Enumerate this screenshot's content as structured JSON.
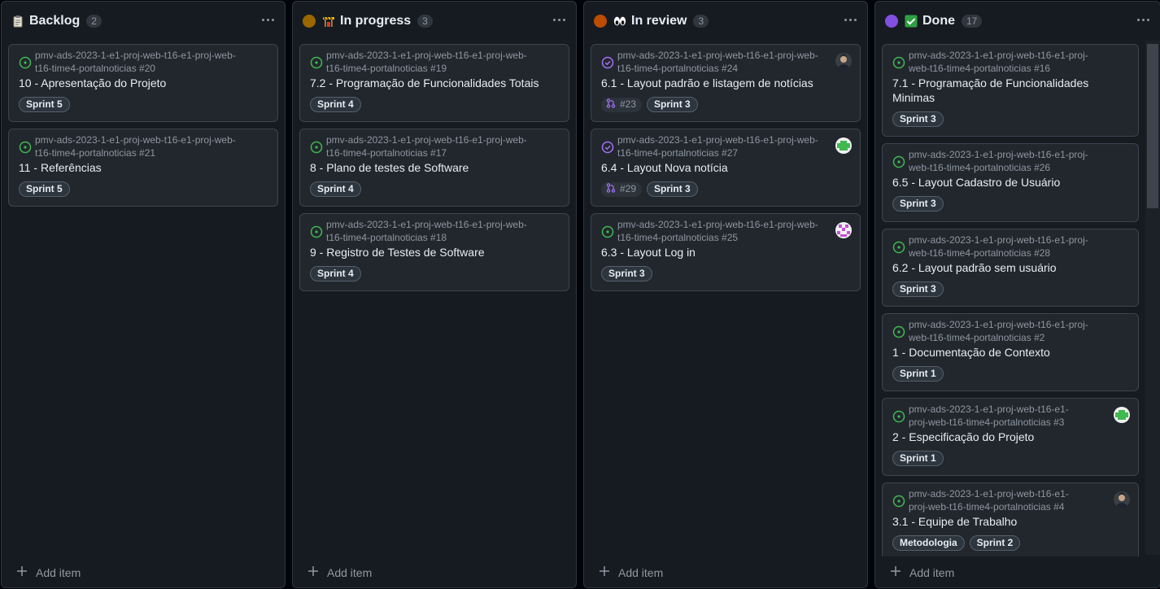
{
  "columns": [
    {
      "title": "Backlog",
      "count": "2",
      "add_item": "Add item",
      "cards": [
        {
          "repo": "pmv-ads-2023-1-e1-proj-web-t16-e1-proj-web-t16-time4-portalnoticias #20",
          "title": "10 - Apresentação do Projeto",
          "labels": [
            "Sprint 5"
          ]
        },
        {
          "repo": "pmv-ads-2023-1-e1-proj-web-t16-e1-proj-web-t16-time4-portalnoticias #21",
          "title": "11 - Referências",
          "labels": [
            "Sprint 5"
          ]
        }
      ]
    },
    {
      "title": "In progress",
      "count": "3",
      "add_item": "Add item",
      "cards": [
        {
          "repo": "pmv-ads-2023-1-e1-proj-web-t16-e1-proj-web-t16-time4-portalnoticias #19",
          "title": "7.2 - Programação de Funcionalidades Totais",
          "labels": [
            "Sprint 4"
          ]
        },
        {
          "repo": "pmv-ads-2023-1-e1-proj-web-t16-e1-proj-web-t16-time4-portalnoticias #17",
          "title": "8 - Plano de testes de Software",
          "labels": [
            "Sprint 4"
          ]
        },
        {
          "repo": "pmv-ads-2023-1-e1-proj-web-t16-e1-proj-web-t16-time4-portalnoticias #18",
          "title": "9 - Registro de Testes de Software",
          "labels": [
            "Sprint 4"
          ]
        }
      ]
    },
    {
      "title": "In review",
      "count": "3",
      "add_item": "Add item",
      "cards": [
        {
          "repo": "pmv-ads-2023-1-e1-proj-web-t16-e1-proj-web-t16-time4-portalnoticias #24",
          "title": "6.1 - Layout padrão e listagem de notícias",
          "pr": "#23",
          "labels": [
            "Sprint 3"
          ]
        },
        {
          "repo": "pmv-ads-2023-1-e1-proj-web-t16-e1-proj-web-t16-time4-portalnoticias #27",
          "title": "6.4 - Layout Nova notícia",
          "pr": "#29",
          "labels": [
            "Sprint 3"
          ]
        },
        {
          "repo": "pmv-ads-2023-1-e1-proj-web-t16-e1-proj-web-t16-time4-portalnoticias #25",
          "title": "6.3 - Layout Log in",
          "labels": [
            "Sprint 3"
          ]
        }
      ]
    },
    {
      "title": "Done",
      "count": "17",
      "add_item": "Add item",
      "cards": [
        {
          "repo": "pmv-ads-2023-1-e1-proj-web-t16-e1-proj-web-t16-time4-portalnoticias #16",
          "title": "7.1 - Programação de Funcionalidades Minimas",
          "labels": [
            "Sprint 3"
          ]
        },
        {
          "repo": "pmv-ads-2023-1-e1-proj-web-t16-e1-proj-web-t16-time4-portalnoticias #26",
          "title": "6.5 - Layout Cadastro de Usuário",
          "labels": [
            "Sprint 3"
          ]
        },
        {
          "repo": "pmv-ads-2023-1-e1-proj-web-t16-e1-proj-web-t16-time4-portalnoticias #28",
          "title": "6.2 - Layout padrão sem usuário",
          "labels": [
            "Sprint 3"
          ]
        },
        {
          "repo": "pmv-ads-2023-1-e1-proj-web-t16-e1-proj-web-t16-time4-portalnoticias #2",
          "title": "1 - Documentação de Contexto",
          "labels": [
            "Sprint 1"
          ]
        },
        {
          "repo": "pmv-ads-2023-1-e1-proj-web-t16-e1-proj-web-t16-time4-portalnoticias #3",
          "title": "2 - Especificação do Projeto",
          "labels": [
            "Sprint 1"
          ]
        },
        {
          "repo": "pmv-ads-2023-1-e1-proj-web-t16-e1-proj-web-t16-time4-portalnoticias #4",
          "title": "3.1 - Equipe de Trabalho",
          "labels": [
            "Metodologia",
            "Sprint 2"
          ]
        }
      ]
    }
  ],
  "colors": {
    "in_progress_dot": "#9a6700",
    "in_review_dot": "#bc4c00",
    "done_dot": "#8250df",
    "open_issue": "#3fb950",
    "closed_issue": "#a371f7"
  }
}
